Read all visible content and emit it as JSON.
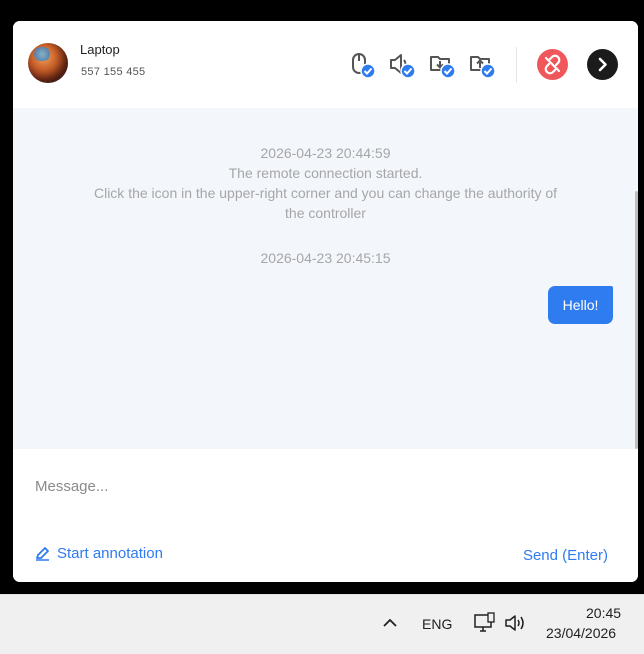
{
  "header": {
    "device_name": "Laptop",
    "device_id": "557 155 455",
    "icons": [
      "mouse-control-icon",
      "audio-control-icon",
      "file-download-icon",
      "file-upload-icon"
    ],
    "disconnect_icon": "unlink-icon",
    "next_icon": "chevron-right-icon"
  },
  "chat": {
    "system_message_1": {
      "timestamp": "2026-04-23 20:44:59",
      "lines": [
        "The remote connection started.",
        "Click the icon in the upper-right corner and you can change the authority of",
        "the controller"
      ]
    },
    "system_message_2": {
      "timestamp": "2026-04-23 20:45:15"
    },
    "outgoing_message": "Hello!"
  },
  "compose": {
    "placeholder": "Message...",
    "annotation_label": "Start annotation",
    "send_label": "Send (Enter)"
  },
  "taskbar": {
    "language": "ENG",
    "time": "20:45",
    "date": "23/04/2026"
  },
  "colors": {
    "accent": "#2f7bf0",
    "danger": "#f0575b",
    "chat_bg": "#f3f6fb"
  }
}
